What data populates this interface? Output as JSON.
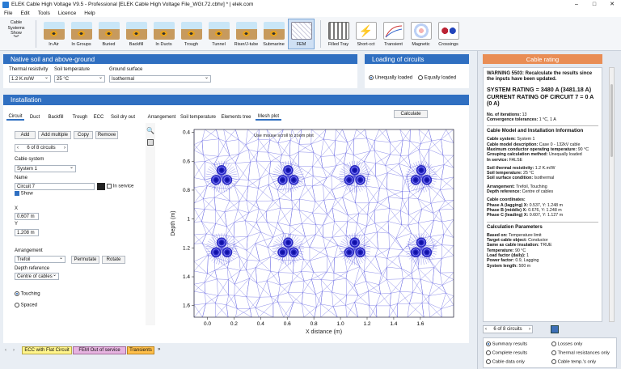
{
  "window": {
    "title": "ELEK Cable High Voltage V9.5 - Professional  [ELEK Cable High Voltage File_WGt.72.cbhv] * | elek.com"
  },
  "menu": [
    "File",
    "Edit",
    "Tools",
    "Licence",
    "Help"
  ],
  "ribbon": {
    "show_label_1": "Cable",
    "show_label_2": "Systems",
    "show_label_3": "Show",
    "buttons": [
      "In Air",
      "In Groups",
      "Buried",
      "Backfill",
      "In Ducts",
      "Trough",
      "Tunnel",
      "Riser/J-tube",
      "Submarine",
      "FEM",
      "Filled Tray",
      "Short-cct",
      "Transient",
      "Magnetic",
      "Crossings"
    ]
  },
  "native_soil": {
    "header": "Native soil and above-ground",
    "thermal_resistivity_label": "Thermal resistivity",
    "thermal_resistivity_value": "1.2 K.m/W",
    "soil_temperature_label": "Soil temperature",
    "soil_temperature_value": "25 °C",
    "ground_surface_label": "Ground surface",
    "ground_surface_value": "Isothermal"
  },
  "loading": {
    "header": "Loading of circuits",
    "unequally": "Unequally loaded",
    "equally": "Equally loaded"
  },
  "installation": {
    "header": "Installation",
    "tabs": [
      "Circuit",
      "Duct",
      "Backfill",
      "Trough",
      "ECC",
      "Soil dry out"
    ],
    "buttons": {
      "add": "Add",
      "add_multiple": "Add multiple",
      "copy": "Copy",
      "remove": "Remove"
    },
    "circuit_nav": "6 of 8 circuits",
    "cable_system_label": "Cable system",
    "cable_system_value": "System 1",
    "name_label": "Name",
    "name_value": "Circuit 7",
    "in_service": "In service",
    "show": "Show",
    "x_label": "X",
    "x_value": "0.607 m",
    "y_label": "Y",
    "y_value": "1.208 m",
    "arrangement_label": "Arrangement",
    "arrangement_value": "Trefoil",
    "permutate": "Permutate",
    "rotate": "Rotate",
    "depth_ref_label": "Depth reference",
    "depth_ref_value": "Centre of cables",
    "touching": "Touching",
    "spaced": "Spaced"
  },
  "plot_tabs": [
    "Arrangement",
    "Soil temperature",
    "Elements tree",
    "Mesh plot"
  ],
  "calculate": "Calculate",
  "chart_data": {
    "type": "scatter",
    "annotation": "Use mouse scroll to zoom plot",
    "xlabel": "X distance (m)",
    "ylabel": "Depth (m)",
    "xlim": [
      -0.1,
      1.85
    ],
    "ylim": [
      1.68,
      0.38
    ],
    "x_ticks": [
      "0.0",
      "0.2",
      "0.4",
      "0.6",
      "0.8",
      "1.0",
      "1.2",
      "1.4",
      "1.6"
    ],
    "y_ticks": [
      "0.4",
      "0.6",
      "0.8",
      "1",
      "1.2",
      "1.4",
      "1.6"
    ],
    "series": [
      {
        "x": [
          0.107,
          0.607,
          1.107,
          1.607,
          0.107,
          0.607,
          1.107,
          1.607
        ],
        "y": [
          0.707,
          0.707,
          0.707,
          0.707,
          1.208,
          1.208,
          1.208,
          1.208
        ]
      }
    ]
  },
  "cable_rating": {
    "header": "Cable rating",
    "warning": "WARNING 5503: Recalculate the results since the inputs have been updated.",
    "system_rating": "SYSTEM RATING = 3480 A (3481.18 A)",
    "current_rating": "CURRENT RATING OF CIRCUIT 7 = 0 A (0 A)",
    "lines": [
      [
        "No. of iterations:",
        " 13"
      ],
      [
        "Convergence tolerances:",
        " 1 °C, 1 A"
      ]
    ],
    "model_header": "Cable Model and Installation Information",
    "model_lines": [
      [
        "Cable system:",
        " System 1"
      ],
      [
        "Cable model description:",
        " Case 0 - 132kV cable"
      ],
      [
        "Maximum conductor operating temperature:",
        " 90 °C"
      ],
      [
        "Grouping calculation method:",
        " Unequally loaded"
      ],
      [
        "In service:",
        " FALSE"
      ]
    ],
    "soil_lines": [
      [
        "Soil thermal resistivity:",
        " 1.2 K.m/W"
      ],
      [
        "Soil temperature:",
        " 25 °C"
      ],
      [
        "Soil surface condition:",
        " Isothermal"
      ]
    ],
    "arr_lines": [
      [
        "Arrangement:",
        " Trefoil, Touching"
      ],
      [
        "Depth reference:",
        " Centre of cables"
      ]
    ],
    "coords_header": "Cable coordinates:",
    "coord_lines": [
      [
        "Phase A (lagging) X:",
        " 0.537, Y: 1.248 m"
      ],
      [
        "Phase B (middle) X:",
        " 0.676, Y: 1.248 m"
      ],
      [
        "Phase C (leading) X:",
        " 0.607, Y: 1.127 m"
      ]
    ],
    "calc_header": "Calculation Parameters",
    "calc_lines": [
      [
        "Based on:",
        " Temperature limit"
      ],
      [
        "Target cable object:",
        " Conductor"
      ],
      [
        "Same as cable insulation:",
        " TRUE"
      ],
      [
        "Temperature:",
        " 90 °C"
      ],
      [
        "Load factor (daily):",
        " 1"
      ],
      [
        "Power factor:",
        " 0.9, Lagging"
      ],
      [
        "System length:",
        " 500 m"
      ]
    ],
    "circuit_nav": "6 of 8 circuits",
    "options": [
      "Summary results",
      "Losses only",
      "Complete results",
      "Thermal resistances only",
      "Cable data only",
      "Cable temp.'s only"
    ]
  },
  "bottom_tabs": [
    "ECC with Flat Circuit",
    "FEM Out of service",
    "Transients"
  ]
}
